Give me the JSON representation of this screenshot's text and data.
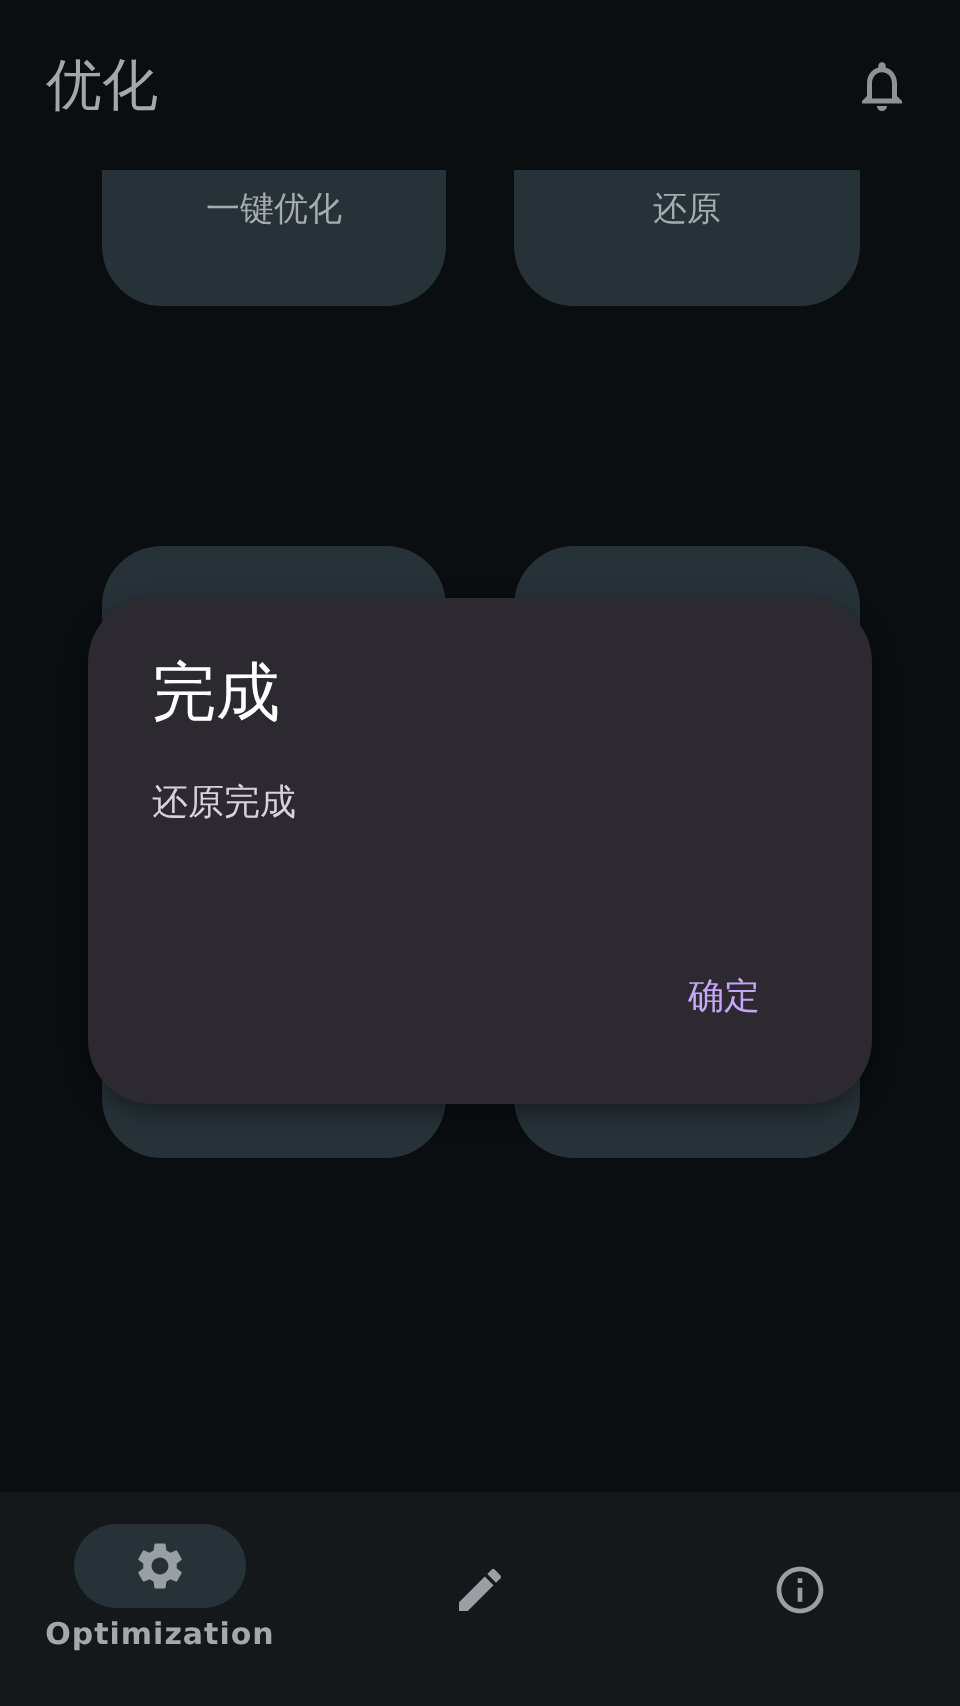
{
  "top_bar": {
    "title": "优化"
  },
  "cards": [
    {
      "label": "一键优化"
    },
    {
      "label": "还原"
    }
  ],
  "dialog": {
    "title": "完成",
    "message": "还原完成",
    "confirm": "确定"
  },
  "nav": [
    {
      "kind": "gear",
      "label": "Optimization",
      "selected": true
    },
    {
      "kind": "pencil",
      "selected": false
    },
    {
      "kind": "info",
      "selected": false
    }
  ]
}
